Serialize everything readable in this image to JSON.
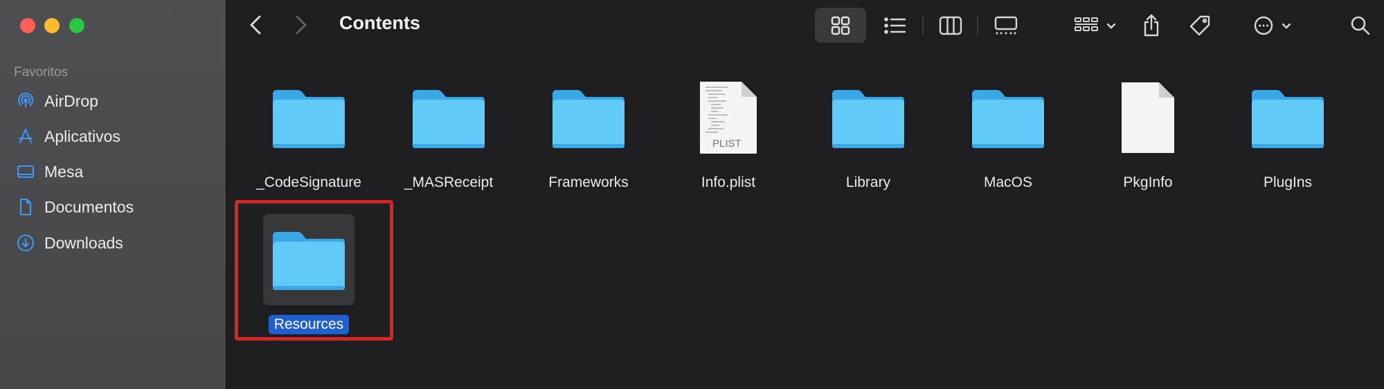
{
  "window": {
    "traffic_lights": {
      "close": "#fe5f57",
      "minimize": "#febc2e",
      "zoom": "#28c840"
    }
  },
  "sidebar": {
    "section_title": "Favoritos",
    "items": [
      {
        "label": "AirDrop",
        "icon": "airdrop-icon"
      },
      {
        "label": "Aplicativos",
        "icon": "applications-icon"
      },
      {
        "label": "Mesa",
        "icon": "desktop-icon"
      },
      {
        "label": "Documentos",
        "icon": "document-icon"
      },
      {
        "label": "Downloads",
        "icon": "downloads-icon"
      }
    ],
    "accent_color": "#3b9cff"
  },
  "toolbar": {
    "title": "Contents",
    "icons": [
      "back-icon",
      "forward-icon",
      "icon-view-icon",
      "list-view-icon",
      "column-view-icon",
      "gallery-view-icon",
      "group-icon",
      "share-icon",
      "tag-icon",
      "more-icon",
      "search-icon"
    ]
  },
  "files": [
    {
      "name": "_CodeSignature",
      "kind": "folder"
    },
    {
      "name": "_MASReceipt",
      "kind": "folder"
    },
    {
      "name": "Frameworks",
      "kind": "folder"
    },
    {
      "name": "Info.plist",
      "kind": "plist",
      "badge": "PLIST"
    },
    {
      "name": "Library",
      "kind": "folder"
    },
    {
      "name": "MacOS",
      "kind": "folder"
    },
    {
      "name": "PkgInfo",
      "kind": "document"
    },
    {
      "name": "PlugIns",
      "kind": "folder"
    },
    {
      "name": "Resources",
      "kind": "folder",
      "selected": true
    }
  ],
  "colors": {
    "folder_light": "#62caf7",
    "folder_dark": "#3aa8e6",
    "selection": "#1f5fcf",
    "highlight_border": "#d72522"
  }
}
